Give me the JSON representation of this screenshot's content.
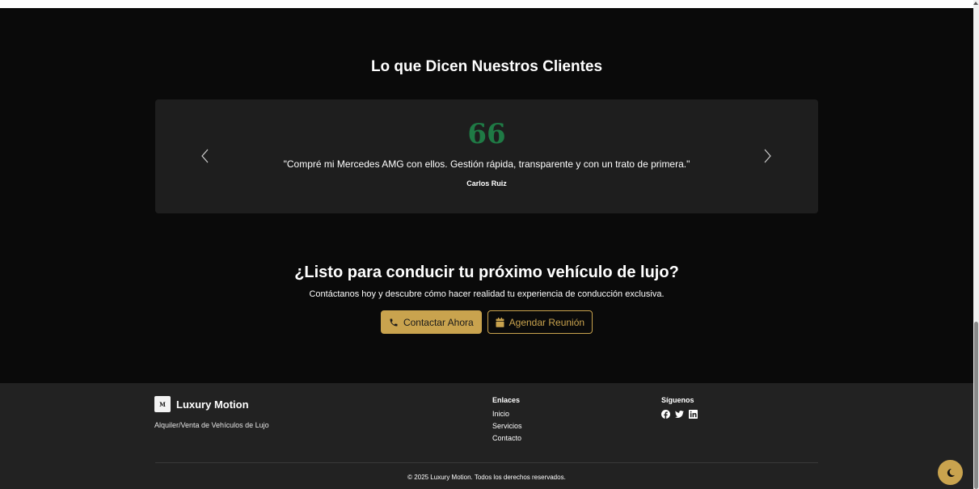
{
  "testimonials": {
    "title": "Lo que Dicen Nuestros Clientes",
    "quote_mark": "66",
    "quote": "\"Compré mi Mercedes AMG con ellos. Gestión rápida, transparente y con un trato de primera.\"",
    "author": "Carlos Ruiz",
    "prev_icon": "chevron-left-icon",
    "next_icon": "chevron-right-icon",
    "quote_color": "#1f7a45"
  },
  "cta": {
    "title": "¿Listo para conducir tu próximo vehículo de lujo?",
    "subtitle": "Contáctanos hoy y descubre cómo hacer realidad tu experiencia de conducción exclusiva.",
    "primary_label": "Contactar Ahora",
    "primary_icon": "phone-icon",
    "secondary_label": "Agendar Reunión",
    "secondary_icon": "calendar-icon",
    "accent_color": "#c9a34e"
  },
  "footer": {
    "brand_logo": "M",
    "brand_name": "Luxury Motion",
    "tagline": "Alquiler/Venta de Vehículos de Lujo",
    "links_title": "Enlaces",
    "links": [
      {
        "label": "Inicio"
      },
      {
        "label": "Servicios"
      },
      {
        "label": "Contacto"
      }
    ],
    "social_title": "Síguenos",
    "social_icons": [
      "facebook-icon",
      "twitter-icon",
      "linkedin-icon"
    ],
    "copyright": "© 2025 Luxury Motion. Todos los derechos reservados.",
    "background": "#222222"
  },
  "theme_toggle": {
    "icon": "moon-icon"
  }
}
